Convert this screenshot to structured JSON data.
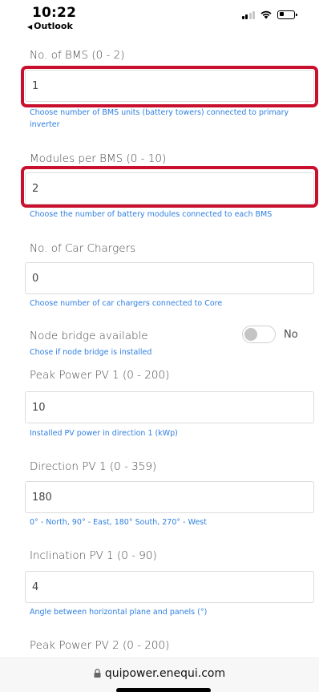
{
  "status": {
    "time": "10:22",
    "back_app": "Outlook",
    "icons": [
      "signal-icon",
      "wifi-icon",
      "battery-icon"
    ]
  },
  "form": {
    "bms": {
      "label": "No. of BMS (0 - 2)",
      "value": "1",
      "hint": "Choose number of BMS units (battery towers) connected to primary inverter"
    },
    "modules": {
      "label": "Modules per BMS (0 - 10)",
      "value": "2",
      "hint": "Choose the number of battery modules connected to each BMS"
    },
    "car_chargers": {
      "label": "No. of Car Chargers",
      "value": "0",
      "hint": "Choose number of car chargers connected to Core"
    },
    "node_bridge": {
      "label": "Node bridge available",
      "toggle_label": "No",
      "toggle_on": false,
      "hint": "Chose if node bridge is installed"
    },
    "peak_pv1": {
      "label": "Peak Power PV 1 (0 - 200)",
      "value": "10",
      "hint": "Installed PV power in direction 1 (kWp)"
    },
    "direction_pv1": {
      "label": "Direction PV 1 (0 - 359)",
      "value": "180",
      "hint": "0° - North, 90° - East, 180° South, 270° - West"
    },
    "inclination_pv1": {
      "label": "Inclination PV 1 (0 - 90)",
      "value": "4",
      "hint": "Angle between horizontal plane and panels (°)"
    },
    "peak_pv2": {
      "label": "Peak Power PV 2 (0 - 200)"
    }
  },
  "browser": {
    "url": "quipower.enequi.com"
  },
  "colors": {
    "highlight": "#c8102e",
    "hint": "#2f7fe0"
  }
}
